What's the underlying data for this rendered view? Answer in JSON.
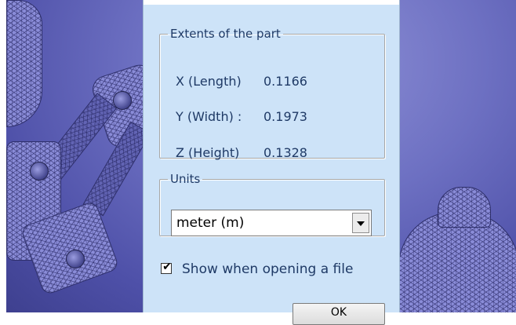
{
  "extents": {
    "legend": "Extents of the part",
    "x": {
      "label": "X (Length)",
      "value": "0.1166"
    },
    "y": {
      "label": "Y (Width) :",
      "value": "0.1973"
    },
    "z": {
      "label": "Z (Height)",
      "value": "0.1328"
    }
  },
  "units": {
    "legend": "Units",
    "selected": "meter (m)"
  },
  "show_on_open": {
    "label": "Show when opening a file",
    "checked": true,
    "mark": "✔"
  },
  "ok_button": {
    "label": "OK"
  },
  "icons": {
    "dropdown": "chevron-down-icon"
  }
}
